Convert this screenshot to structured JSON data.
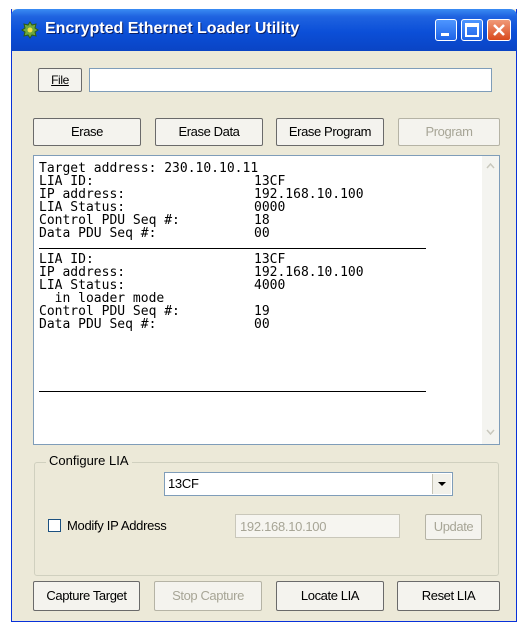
{
  "window": {
    "title": "Encrypted Ethernet Loader Utility"
  },
  "file": {
    "button_label": "File",
    "path_value": ""
  },
  "actions": {
    "erase": "Erase",
    "erase_data": "Erase Data",
    "erase_program": "Erase Program",
    "program": "Program"
  },
  "log": {
    "line1": "Target address: 230.10.10.11",
    "block1": [
      {
        "label": "LIA ID:",
        "value": "13CF"
      },
      {
        "label": "IP address:",
        "value": "192.168.10.100"
      },
      {
        "label": "LIA Status:",
        "value": "0000"
      },
      {
        "label": "Control PDU Seq #:",
        "value": "18"
      },
      {
        "label": "Data PDU Seq #:",
        "value": "00"
      }
    ],
    "block2": [
      {
        "label": "LIA ID:",
        "value": "13CF"
      },
      {
        "label": "IP address:",
        "value": "192.168.10.100"
      },
      {
        "label": "LIA Status:",
        "value": "4000"
      },
      {
        "label": "  in loader mode",
        "value": ""
      },
      {
        "label": "Control PDU Seq #:",
        "value": "19"
      },
      {
        "label": "Data PDU Seq #:",
        "value": "00"
      }
    ]
  },
  "configure": {
    "group_label": "Configure LIA",
    "selected_lia": "13CF",
    "modify_ip_label": "Modify IP Address",
    "ip_value": "192.168.10.100",
    "update_label": "Update"
  },
  "bottom": {
    "capture_target": "Capture Target",
    "stop_capture": "Stop Capture",
    "locate_lia": "Locate LIA",
    "reset_lia": "Reset LIA"
  }
}
